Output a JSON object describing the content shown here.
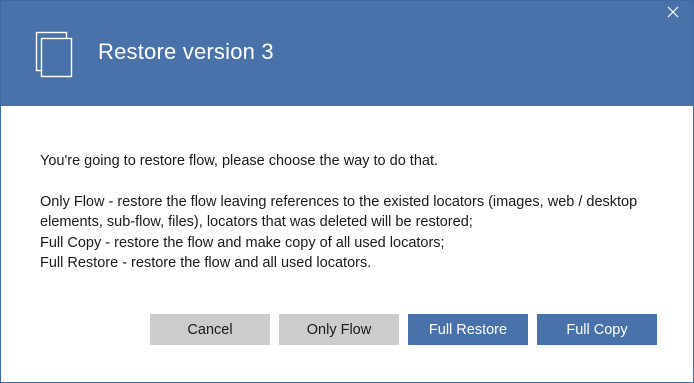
{
  "dialog": {
    "title": "Restore version 3",
    "close_icon": "close-icon",
    "header_icon": "document-copy-icon",
    "colors": {
      "header": "#4a72aa",
      "primary_button": "#4a72aa",
      "secondary_button": "#cccccc"
    }
  },
  "message": {
    "intro": "You're going to restore flow, please choose the way to do that.",
    "lines": [
      "Only Flow - restore the flow leaving references to the existed locators (images, web / desktop",
      "elements, sub-flow, files),  locators that was deleted will be restored;",
      "Full Copy - restore the flow and make copy of all used locators;",
      "Full Restore - restore the flow and all used locators."
    ]
  },
  "buttons": {
    "cancel": "Cancel",
    "only_flow": "Only Flow",
    "full_restore": "Full Restore",
    "full_copy": "Full Copy"
  }
}
